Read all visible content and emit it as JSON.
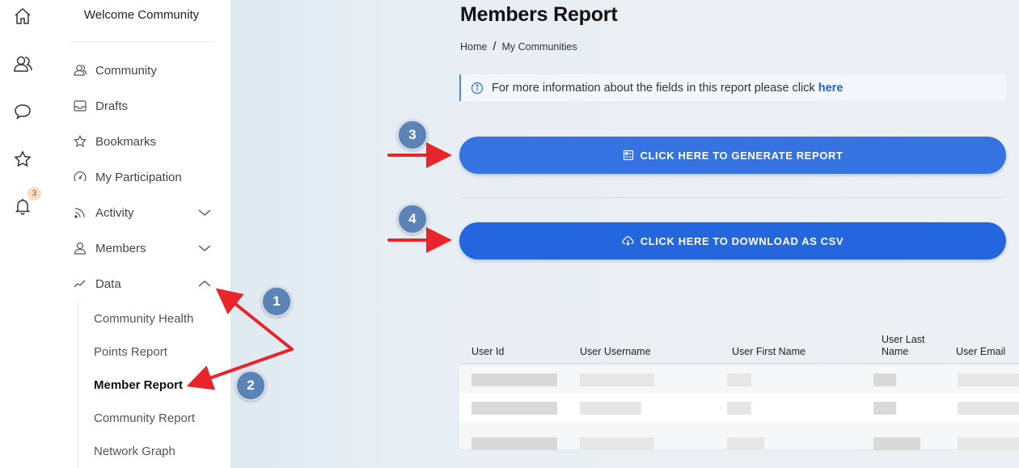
{
  "community_title": "Welcome Community",
  "rail": {
    "icons": [
      "home-icon",
      "people-icon",
      "chat-icon",
      "star-icon",
      "bell-icon"
    ],
    "notification_count": "3"
  },
  "menu": {
    "community": "Community",
    "drafts": "Drafts",
    "bookmarks": "Bookmarks",
    "my_participation": "My Participation",
    "activity": "Activity",
    "members": "Members",
    "data": "Data",
    "data_children": {
      "community_health": "Community Health",
      "points_report": "Points Report",
      "member_report": "Member Report",
      "community_report": "Community Report",
      "network_graph": "Network Graph"
    }
  },
  "page": {
    "title": "Members Report",
    "breadcrumb": [
      "Home",
      "/",
      "My Communities"
    ],
    "info_text": "For more information about the fields in this report please click",
    "info_link": "here",
    "generate_button": "CLICK HERE TO GENERATE REPORT",
    "download_button": "CLICK HERE TO DOWNLOAD AS CSV"
  },
  "annotations": [
    "1",
    "2",
    "3",
    "4"
  ],
  "table": {
    "columns": [
      "User Id",
      "User Username",
      "User First Name",
      "User Last Name",
      "User Email"
    ]
  },
  "colors": {
    "primary_button": "#2f6fe0",
    "annotation_marker": "#5b83b6",
    "arrow": "#e8252b",
    "link": "#1f66d8"
  }
}
